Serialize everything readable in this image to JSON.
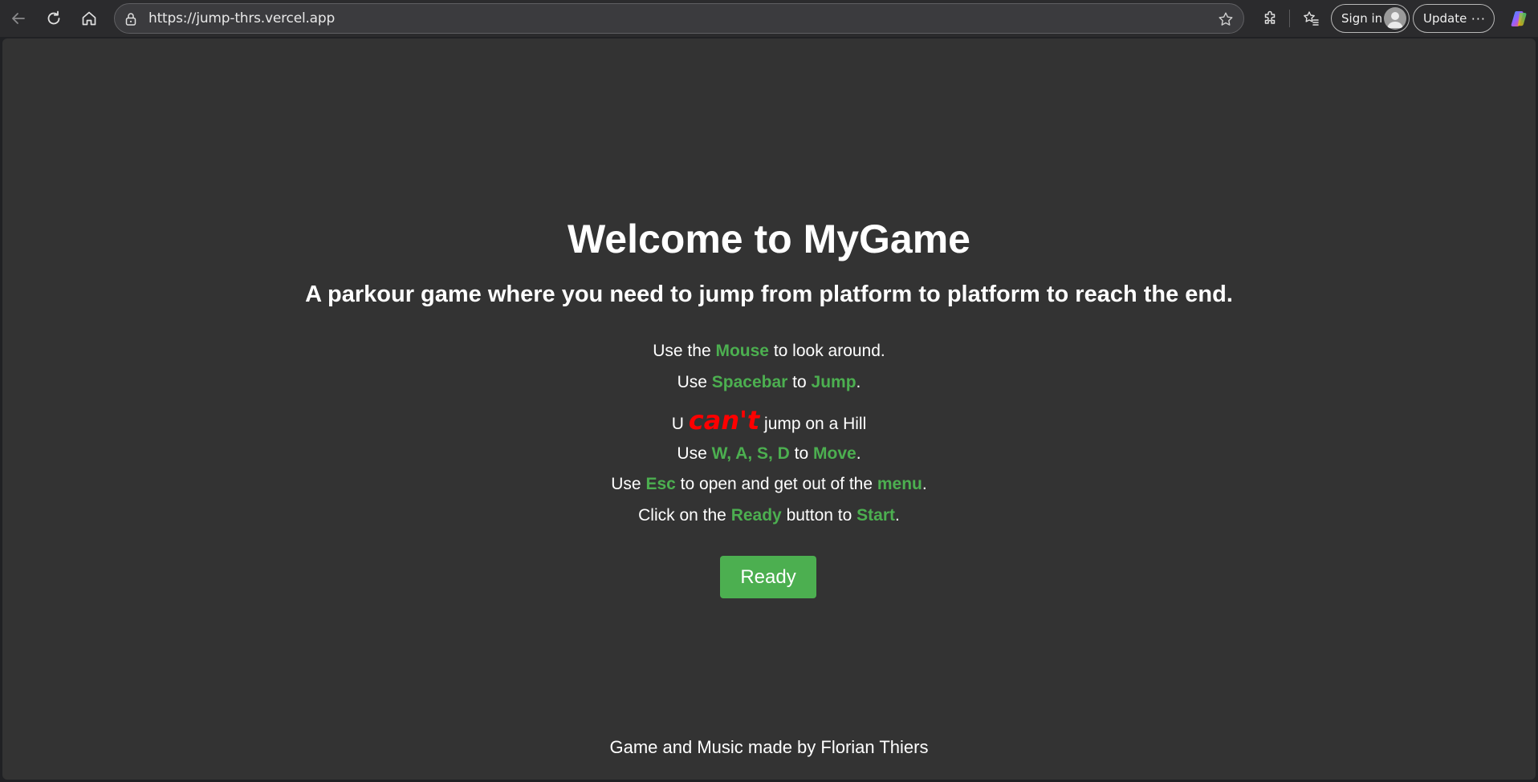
{
  "browser": {
    "url": "https://jump-thrs.vercel.app",
    "sign_in_label": "Sign in",
    "update_label": "Update",
    "more_label": "···"
  },
  "page": {
    "title": "Welcome to MyGame",
    "subtitle": "A parkour game where you need to jump from platform to platform to reach the end.",
    "instructions": {
      "mouse": {
        "pre": "Use the ",
        "key": "Mouse",
        "post": " to look around."
      },
      "spacebar": {
        "pre": "Use ",
        "key": "Spacebar",
        "mid": " to ",
        "action": "Jump",
        "post": "."
      },
      "hill": {
        "pre": "U ",
        "emph": "can't",
        "post": " jump on a Hill"
      },
      "move": {
        "pre": "Use ",
        "key": "W, A, S, D",
        "mid": " to ",
        "action": "Move",
        "post": "."
      },
      "esc": {
        "pre": "Use ",
        "key": "Esc",
        "mid": " to open and get out of the ",
        "action": "menu",
        "post": "."
      },
      "ready": {
        "pre": "Click on the ",
        "key": "Ready",
        "mid": " button to ",
        "action": "Start",
        "post": "."
      }
    },
    "ready_button": "Ready",
    "footer": "Game and Music made by Florian Thiers"
  },
  "colors": {
    "page_bg": "#333333",
    "accent_green": "#4caf50",
    "warning_red": "#ff0000"
  }
}
